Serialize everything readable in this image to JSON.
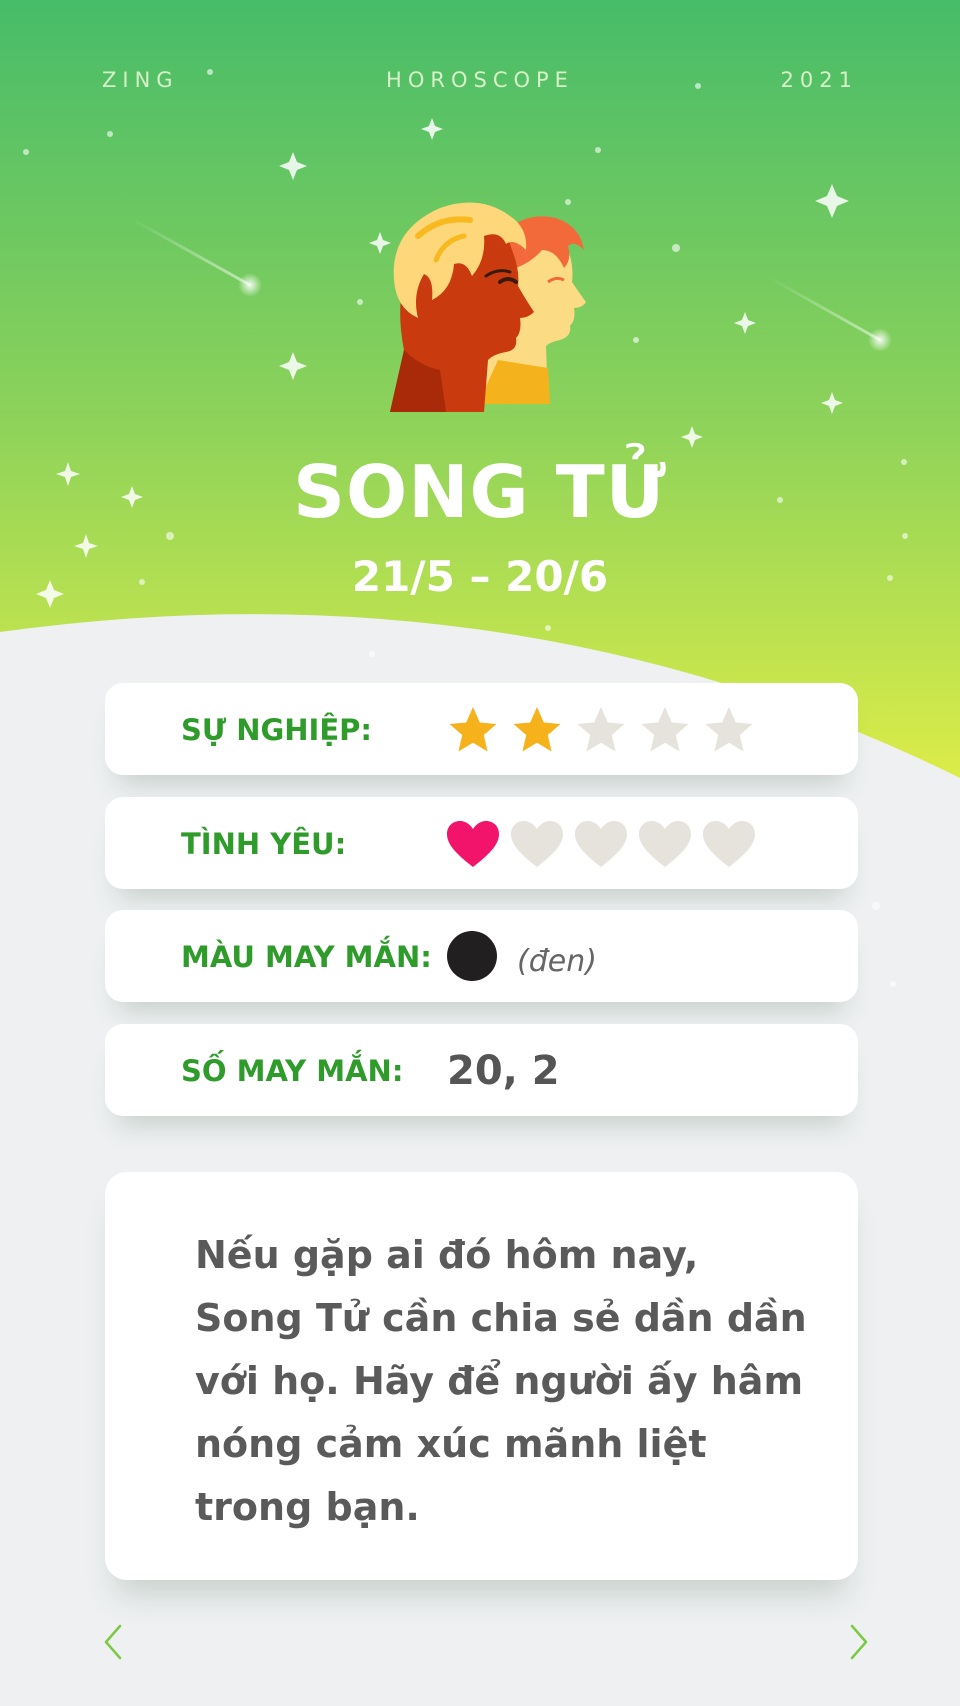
{
  "header": {
    "left": "ZING",
    "center": "HOROSCOPE",
    "right": "2021"
  },
  "sign": {
    "name": "SONG TỬ",
    "dates": "21/5 – 20/6",
    "icon": "gemini-twins-icon"
  },
  "stats": {
    "career": {
      "label": "SỰ NGHIỆP:",
      "value": 2,
      "max": 5,
      "icon": "star-icon"
    },
    "love": {
      "label": "TÌNH YÊU:",
      "value": 1,
      "max": 5,
      "icon": "heart-icon"
    },
    "lucky_color": {
      "label": "MÀU MAY MẮN:",
      "color_hex": "#221f20",
      "color_name": "(đen)"
    },
    "lucky_number": {
      "label": "SỐ MAY MẮN:",
      "value": "20, 2"
    }
  },
  "description": "Nếu gặp ai đó hôm nay, Song Tử cần chia sẻ dần dần với họ. Hãy để người ấy hâm nóng cảm xúc mãnh liệt trong bạn.",
  "navigation": {
    "prev_icon": "chevron-left-icon",
    "next_icon": "chevron-right-icon"
  },
  "colors": {
    "gradient_top": "#4cbc68",
    "gradient_bottom": "#dcec4a",
    "label_green": "#2e9b2a",
    "star_active": "#f6b21a",
    "heart_active": "#f2136b",
    "inactive": "#e6e3dc",
    "background": "#eef0f2"
  }
}
